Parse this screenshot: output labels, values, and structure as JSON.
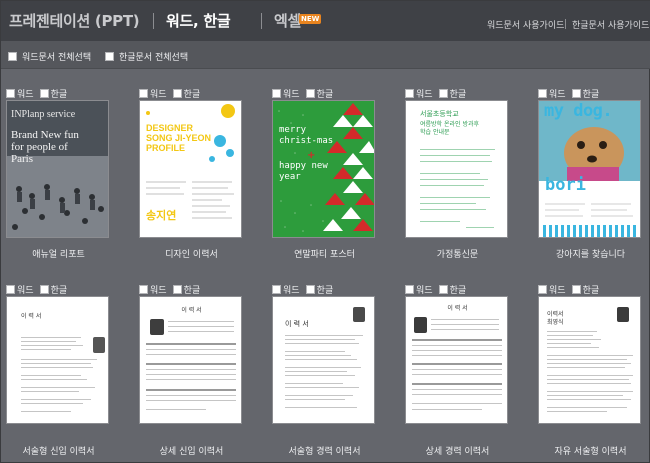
{
  "header": {
    "tabs": [
      {
        "label": "프레젠테이션 (PPT)"
      },
      {
        "label": "워드, 한글"
      },
      {
        "label": "엑셀"
      }
    ],
    "new_badge": "NEW",
    "guides": [
      "워드문서 사용가이드",
      "한글문서 사용가이드"
    ]
  },
  "select_all": {
    "word": "워드문서 전체선택",
    "hangul": "한글문서 전체선택"
  },
  "option_labels": {
    "word": "워드",
    "hangul": "한글"
  },
  "templates": [
    {
      "title": "애뉴얼 리포트",
      "thumb_text": [
        "INPlanp service",
        "Brand New fun for people of Paris"
      ]
    },
    {
      "title": "디자인 이력서",
      "thumb_text": [
        "DESIGNER",
        "SONG JI-YEON",
        "PROFILE",
        "송지연"
      ]
    },
    {
      "title": "연말파티 포스터",
      "thumb_text": [
        "merry christ-mas",
        "+",
        "happy new year"
      ]
    },
    {
      "title": "가정통신문",
      "thumb_text": [
        "서울초등학교",
        "여름방학 온라인 방과후학습 안내문"
      ]
    },
    {
      "title": "강아지를 찾습니다",
      "thumb_text": [
        "my dog.",
        "bori"
      ]
    },
    {
      "title": "서술형 신입 이력서",
      "thumb_text": [
        "이 력 서"
      ]
    },
    {
      "title": "상세 신입 이력서",
      "thumb_text": [
        "이 력 서"
      ]
    },
    {
      "title": "서술형 경력 이력서",
      "thumb_text": [
        "이 력 서"
      ]
    },
    {
      "title": "상세 경력 이력서",
      "thumb_text": [
        "이 력 서"
      ]
    },
    {
      "title": "자유 서술형 이력서",
      "thumb_text": [
        "이력서",
        "최영식"
      ]
    }
  ],
  "colors": {
    "topbar": "#3f4146",
    "page_bg": "#64666c",
    "selbar": "#55575c",
    "xmas_green": "#2d9c3c",
    "xmas_red": "#d42a2a",
    "designer_yellow": "#f3c714",
    "dog_cyan": "#3ab6e0",
    "letter_green": "#2c9c52"
  }
}
